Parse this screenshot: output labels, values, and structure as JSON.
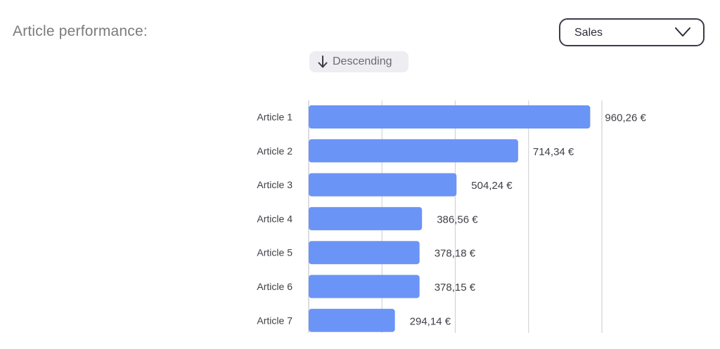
{
  "header": {
    "title": "Article performance:"
  },
  "metric_select": {
    "value": "Sales"
  },
  "sort_toggle": {
    "label": "Descending",
    "icon": "arrow-down-icon"
  },
  "colors": {
    "bar": "#6b94f7",
    "grid": "#d3d3d8",
    "title": "#7b7b7f",
    "label": "#3f3f46"
  },
  "chart_data": {
    "type": "bar",
    "orientation": "horizontal",
    "categories": [
      "Article 1",
      "Article 2",
      "Article 3",
      "Article 4",
      "Article 5",
      "Article 6",
      "Article 7"
    ],
    "values": [
      960.26,
      714.34,
      504.24,
      386.56,
      378.18,
      378.15,
      294.14
    ],
    "value_labels": [
      "960,26 €",
      "714,34 €",
      "504,24 €",
      "386,56 €",
      "378,18 €",
      "378,15 €",
      "294,14 €"
    ],
    "xlim": [
      0,
      1000
    ],
    "grid": true,
    "sort": "descending"
  }
}
